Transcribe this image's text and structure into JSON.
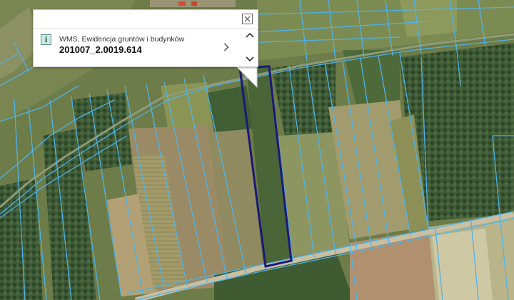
{
  "popup": {
    "source_label": "WMS, Ewidencja gruntów i budynków",
    "parcel_id": "201007_2.0019.614",
    "info_icon": "i",
    "icons": {
      "info": "info-icon",
      "close": "close-icon",
      "next": "chevron-right-icon",
      "scroll_up": "chevron-up-icon",
      "scroll_down": "chevron-down-icon"
    }
  },
  "colors": {
    "parcel_boundary": "#4fb3e8",
    "selected_parcel": "#1b1877",
    "popup_background": "#ffffff"
  }
}
